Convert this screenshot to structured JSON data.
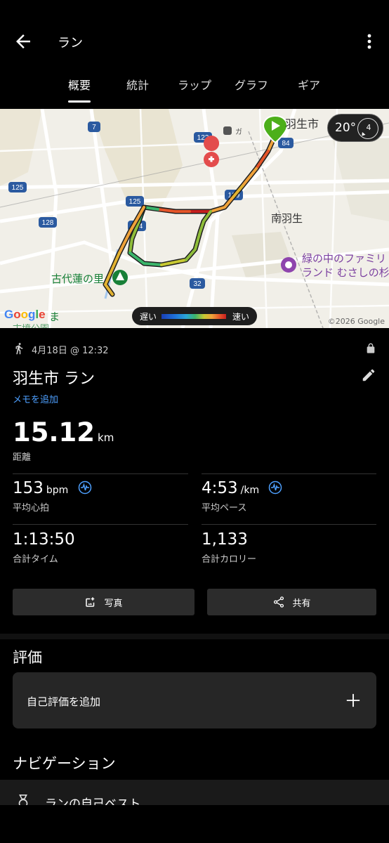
{
  "header": {
    "title": "ラン",
    "back_icon": "arrow-left-icon",
    "menu_icon": "more-vert-icon"
  },
  "tabs": [
    "概要",
    "統計",
    "ラップ",
    "グラフ",
    "ギア"
  ],
  "active_tab": 0,
  "map": {
    "labels": {
      "city": "羽生市",
      "south_hanyu": "南羽生",
      "kodai_hasu": "古代蓮の里",
      "family_land_line1": "緑の中のファミリ",
      "family_land_line2": "ランド むさしの杉",
      "park": "古墳公園",
      "suffix_ma": "ま"
    },
    "road_shields": [
      "7",
      "125",
      "128",
      "122",
      "364",
      "129",
      "84",
      "125",
      "32"
    ],
    "weather": {
      "temp": "20°",
      "wind": "4"
    },
    "legend": {
      "slow": "遅い",
      "fast": "速い"
    },
    "google": "Google",
    "copyright": "©2026 Google",
    "colors": {
      "route_slow": "#3bb56b",
      "route_mid": "#f0a23a",
      "route_fast": "#c51f1f",
      "start_pin": "#4caf1a"
    }
  },
  "activity": {
    "date": "4月18日 @ 12:32",
    "title": "羽生市 ラン",
    "memo_link": "メモを追加",
    "distance": {
      "value": "15.12",
      "unit": "km",
      "label": "距離"
    },
    "stats": {
      "heart_rate": {
        "value": "153",
        "unit": "bpm",
        "label": "平均心拍"
      },
      "pace": {
        "value": "4:53",
        "unit": "/km",
        "label": "平均ペース"
      },
      "time": {
        "value": "1:13:50",
        "label": "合計タイム"
      },
      "calories": {
        "value": "1,133",
        "label": "合計カロリー"
      }
    }
  },
  "buttons": {
    "photo": "写真",
    "share": "共有"
  },
  "rating": {
    "section_title": "評価",
    "add_label": "自己評価を追加"
  },
  "navigation": {
    "section_title": "ナビゲーション",
    "item_label": "ランの自己ベスト"
  }
}
